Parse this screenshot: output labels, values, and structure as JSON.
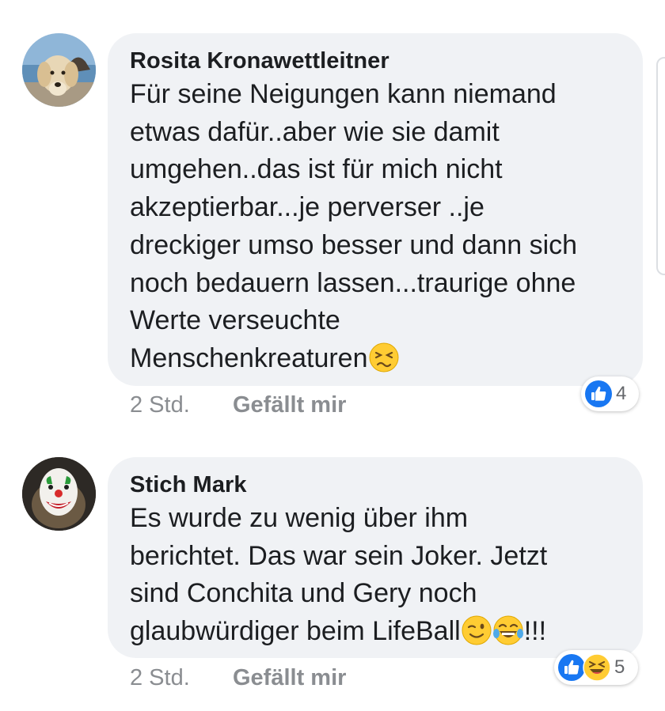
{
  "comments": [
    {
      "author": "Rosita Kronawettleitner",
      "text": "Für seine Neigungen kann niemand\netwas dafür..aber wie sie damit\numgehen..das ist für mich nicht\nakzeptierbar...je perverser ..je\ndreckiger umso besser und dann sich\nnoch bedauern lassen...traurige ohne\nWerte  verseuchte\nMenschenkreaturen",
      "trailing_emoji": "persevering-face",
      "time": "2 Std.",
      "like_label": "Gefällt mir",
      "reaction_count": "4",
      "reactions": [
        "like"
      ]
    },
    {
      "author": "Stich Mark",
      "text_lines_before": "Es wurde zu wenig über ihm\nberichtet. Das war sein Joker. Jetzt\nsind Conchita und Gery noch\nglaubwürdiger beim LifeBall",
      "text_after": "!!!",
      "inline_emojis": [
        "winking-face",
        "tears-of-joy-face"
      ],
      "time": "2 Std.",
      "like_label": "Gefällt mir",
      "reaction_count": "5",
      "reactions": [
        "like",
        "haha"
      ]
    }
  ],
  "colors": {
    "bubble": "#f0f2f5",
    "like_blue": "#1877f2",
    "meta_gray": "#8a8d91",
    "emoji_yellow": "#ffcc33"
  }
}
